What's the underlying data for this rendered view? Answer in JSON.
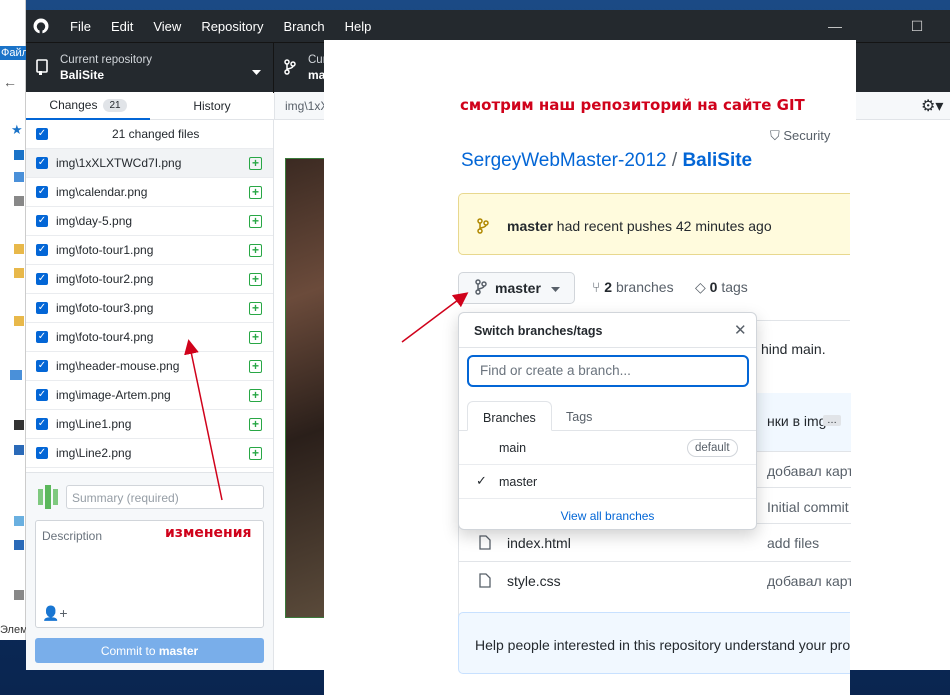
{
  "explorer": {
    "menu_label": "Файл",
    "bottom_label": "Элем"
  },
  "app": {
    "menu": [
      "File",
      "Edit",
      "View",
      "Repository",
      "Branch",
      "Help"
    ],
    "current_repo_label": "Current repository",
    "current_repo": "BaliSite",
    "current_branch_label": "Current branch",
    "current_branch": "master"
  },
  "tabs": {
    "changes": "Changes",
    "changes_count": "21",
    "history": "History"
  },
  "selected_file_path": "img\\1xXLXTWCd7I.png",
  "changes": {
    "all_label": "21 changed files",
    "files": [
      "img\\1xXLXTWCd7I.png",
      "img\\calendar.png",
      "img\\day-5.png",
      "img\\foto-tour1.png",
      "img\\foto-tour2.png",
      "img\\foto-tour3.png",
      "img\\foto-tour4.png",
      "img\\header-mouse.png",
      "img\\image-Artem.png",
      "img\\Line1.png",
      "img\\Line2.png"
    ]
  },
  "commit": {
    "summary_placeholder": "Summary (required)",
    "description_placeholder": "Description",
    "button_prefix": "Commit to ",
    "button_branch": "master"
  },
  "annotations": {
    "top": "смотрим наш репозиторий на сайте GIT",
    "left": "изменения"
  },
  "github": {
    "nav_partial": "Security",
    "owner": "SergeyWebMaster-2012",
    "separator": "/",
    "repo": "BaliSite",
    "recent_branch": "master",
    "recent_text": " had recent pushes 42 minutes ago",
    "branch_button": "master",
    "branches_count": "2",
    "branches_label": " branches",
    "tags_count": "0",
    "tags_label": " tags",
    "behind_text": "hind main.",
    "folder_msg": "нки в img",
    "files": [
      {
        "name": "",
        "msg": "добавал карт"
      },
      {
        "name": "",
        "msg": "Initial commit"
      },
      {
        "name": "index.html",
        "msg": "add files"
      },
      {
        "name": "style.css",
        "msg": "добавал карт"
      }
    ],
    "help_text": "Help people interested in this repository understand your pro"
  },
  "dropdown": {
    "title": "Switch branches/tags",
    "find_placeholder": "Find or create a branch...",
    "tab_branches": "Branches",
    "tab_tags": "Tags",
    "branches": [
      {
        "name": "main",
        "badge": "default"
      },
      {
        "name": "master",
        "selected": true
      }
    ],
    "view_all": "View all branches"
  },
  "colors": {
    "titlebar": "#24292e",
    "accent": "#0366d6",
    "add_green": "#28a745",
    "annotation_red": "#d0021b"
  }
}
